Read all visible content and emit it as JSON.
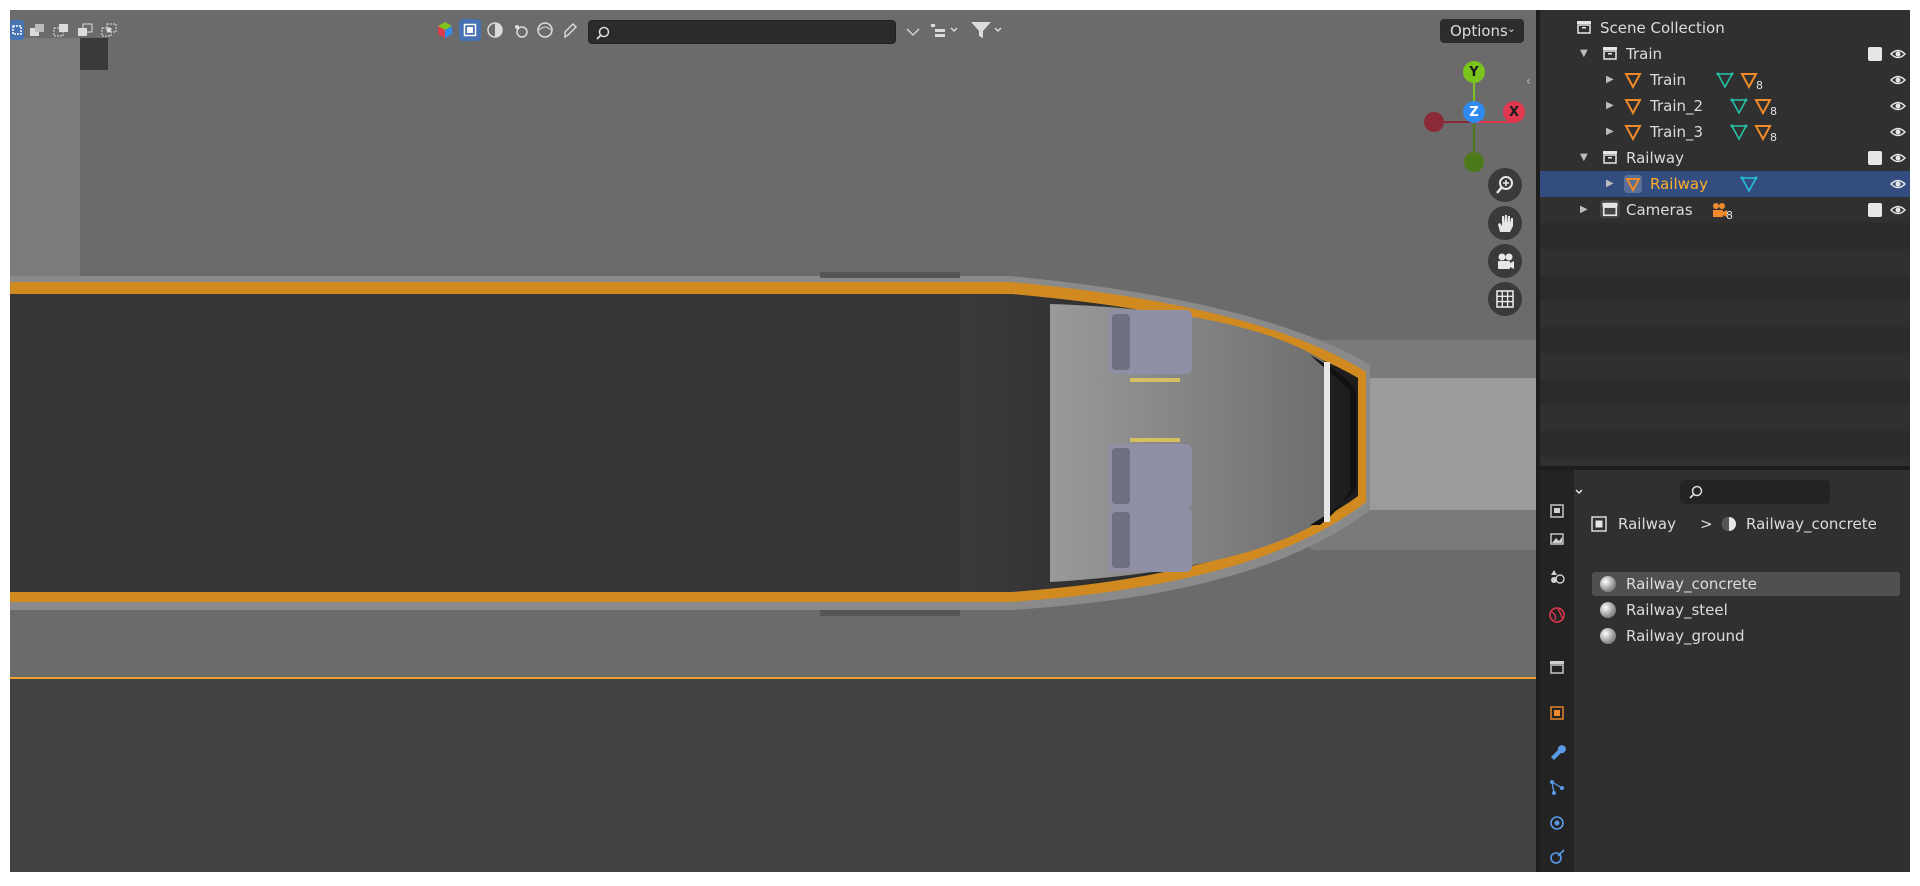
{
  "viewport": {
    "search_placeholder": "",
    "options_label": "Options",
    "gizmo": {
      "y_label": "Y",
      "z_label": "Z",
      "x_label": "X"
    }
  },
  "outliner": {
    "scene_collection": "Scene Collection",
    "rows": [
      {
        "label": "Train",
        "kind": "collection",
        "sub_count": ""
      },
      {
        "label": "Train",
        "kind": "mesh",
        "sub_count": "8"
      },
      {
        "label": "Train_2",
        "kind": "mesh",
        "sub_count": "8"
      },
      {
        "label": "Train_3",
        "kind": "mesh",
        "sub_count": "8"
      },
      {
        "label": "Railway",
        "kind": "collection",
        "sub_count": ""
      },
      {
        "label": "Railway",
        "kind": "mesh",
        "sub_count": "",
        "selected": true
      },
      {
        "label": "Cameras",
        "kind": "collection",
        "sub_count": "8"
      }
    ]
  },
  "properties": {
    "search_placeholder": "",
    "breadcrumb": {
      "object": "Railway",
      "separator": ">",
      "material": "Railway_concrete"
    },
    "material_slots": [
      "Railway_concrete",
      "Railway_steel",
      "Railway_ground"
    ]
  },
  "colors": {
    "accent_orange": "#ffaf29",
    "selection_blue": "#334d80",
    "active_button": "#4772b3",
    "axis_x": "#e0384f",
    "axis_y": "#7bc41d",
    "axis_z": "#2f8bf0"
  }
}
